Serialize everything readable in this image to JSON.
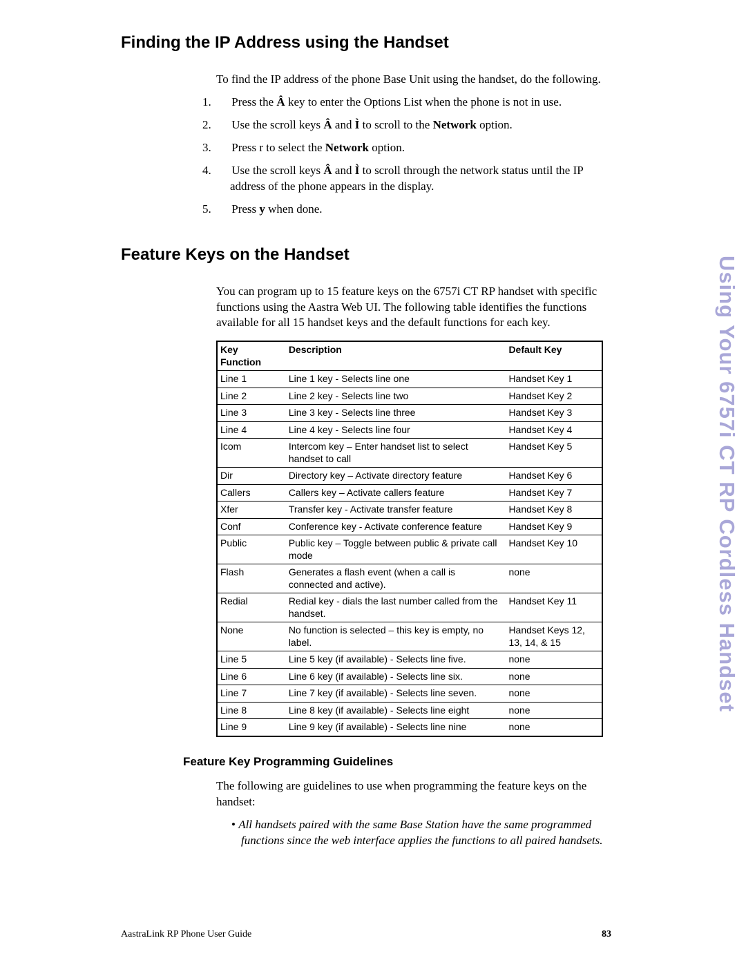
{
  "sideTab": "Using Your 6757i CT RP Cordless Handset",
  "footer": {
    "guide": "AastraLink RP Phone User Guide",
    "page": "83"
  },
  "section1": {
    "title": "Finding the IP Address using the Handset",
    "intro": "To find the IP address of the phone Base Unit using the handset, do the following.",
    "steps": [
      {
        "n": "1.",
        "html": "Press the <b>Â</b> key to enter the Options List when the phone is not in use."
      },
      {
        "n": "2.",
        "html": "Use the scroll keys <b>Â</b> and <b>Ì</b> to scroll to the <b>Network</b> option."
      },
      {
        "n": "3.",
        "html": "Press r to select the <b>Network</b> option."
      },
      {
        "n": "4.",
        "html": "Use the scroll keys <b>Â</b> and <b>Ì</b> to scroll through the network status until the IP address of the phone appears in the display."
      },
      {
        "n": "5.",
        "html": "Press <b>y</b> when done."
      }
    ]
  },
  "section2": {
    "title": "Feature Keys on the Handset",
    "intro": "You can program up to 15 feature keys on the 6757i CT RP handset with specific functions using the Aastra Web UI. The following table identifies the functions available for all 15 handset keys and the default functions for each key.",
    "table": {
      "headers": {
        "func": "Key\nFunction",
        "desc": "Description",
        "def": "Default Key"
      },
      "rows": [
        {
          "func": "Line 1",
          "desc": "Line 1 key - Selects line one",
          "def": "Handset Key 1"
        },
        {
          "func": "Line 2",
          "desc": "Line 2 key - Selects line two",
          "def": "Handset Key 2"
        },
        {
          "func": "Line 3",
          "desc": "Line 3 key - Selects line three",
          "def": "Handset Key 3"
        },
        {
          "func": "Line 4",
          "desc": "Line 4 key - Selects line four",
          "def": "Handset Key 4"
        },
        {
          "func": "Icom",
          "desc": "Intercom key – Enter handset list to select handset to call",
          "def": "Handset Key 5"
        },
        {
          "func": "Dir",
          "desc": "Directory key – Activate directory feature",
          "def": "Handset Key 6"
        },
        {
          "func": "Callers",
          "desc": "Callers key – Activate callers feature",
          "def": "Handset Key 7"
        },
        {
          "func": "Xfer",
          "desc": "Transfer key - Activate transfer feature",
          "def": "Handset Key 8"
        },
        {
          "func": "Conf",
          "desc": "Conference key - Activate conference feature",
          "def": "Handset Key 9"
        },
        {
          "func": "Public",
          "desc": "Public key – Toggle between public & private call mode",
          "def": "Handset Key 10"
        },
        {
          "func": "Flash",
          "desc": "Generates a flash event (when a call is connected and active).",
          "def": "none"
        },
        {
          "func": "Redial",
          "desc": "Redial key - dials the last number called from the handset.",
          "def": "Handset Key 11"
        },
        {
          "func": "None",
          "desc": "No function is selected – this key is empty, no label.",
          "def": "Handset Keys 12, 13, 14, & 15"
        },
        {
          "func": "Line 5",
          "desc": "Line 5 key (if available) - Selects line five.",
          "def": "none"
        },
        {
          "func": "Line 6",
          "desc": "Line 6 key (if available) - Selects line six.",
          "def": "none"
        },
        {
          "func": "Line 7",
          "desc": "Line 7 key (if available) - Selects line seven.",
          "def": "none"
        },
        {
          "func": "Line 8",
          "desc": "Line 8 key (if available) - Selects line eight",
          "def": "none"
        },
        {
          "func": "Line 9",
          "desc": "Line 9 key (if available) - Selects line nine",
          "def": "none"
        }
      ]
    },
    "sub": {
      "title": "Feature Key Programming Guidelines",
      "intro": "The following are guidelines to use when programming the feature keys on the handset:",
      "bullets": [
        "All handsets paired with the same Base Station have the same programmed functions since the web interface applies the functions to all paired handsets."
      ]
    }
  }
}
